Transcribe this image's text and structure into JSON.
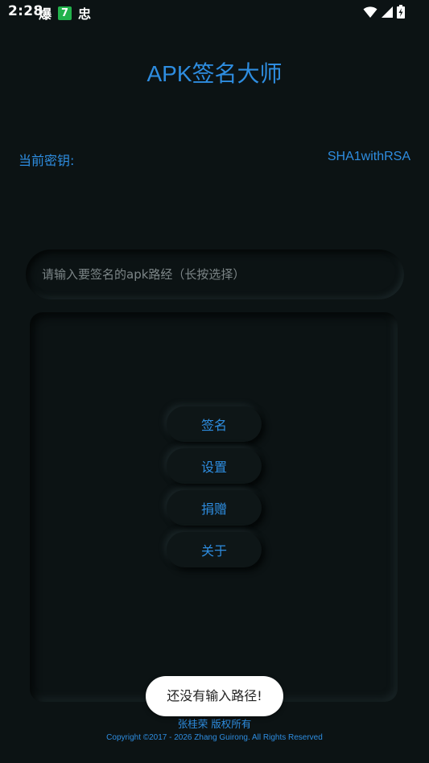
{
  "status_bar": {
    "time": "2:28",
    "notif_1": "爆",
    "notif_2": "7",
    "notif_3": "忠",
    "icons": [
      "wifi-icon",
      "signal-icon",
      "battery-charging-icon"
    ]
  },
  "header": {
    "title": "APK签名大师"
  },
  "key": {
    "label": "当前密钥:",
    "value": "SHA1withRSA"
  },
  "path_input": {
    "value": "",
    "placeholder": "请输入要签名的apk路经（长按选择）"
  },
  "actions": {
    "sign": "签名",
    "settings": "设置",
    "donate": "捐赠",
    "about": "关于"
  },
  "toast": {
    "message": "还没有输入路径!"
  },
  "footer": {
    "author": "张桂荣  版权所有",
    "copyright": "Copyright ©2017 - 2026 Zhang Guirong. All Rights Reserved"
  },
  "colors": {
    "background": "#0c1314",
    "accent": "#2e8de0",
    "toast_background": "#ffffff"
  }
}
